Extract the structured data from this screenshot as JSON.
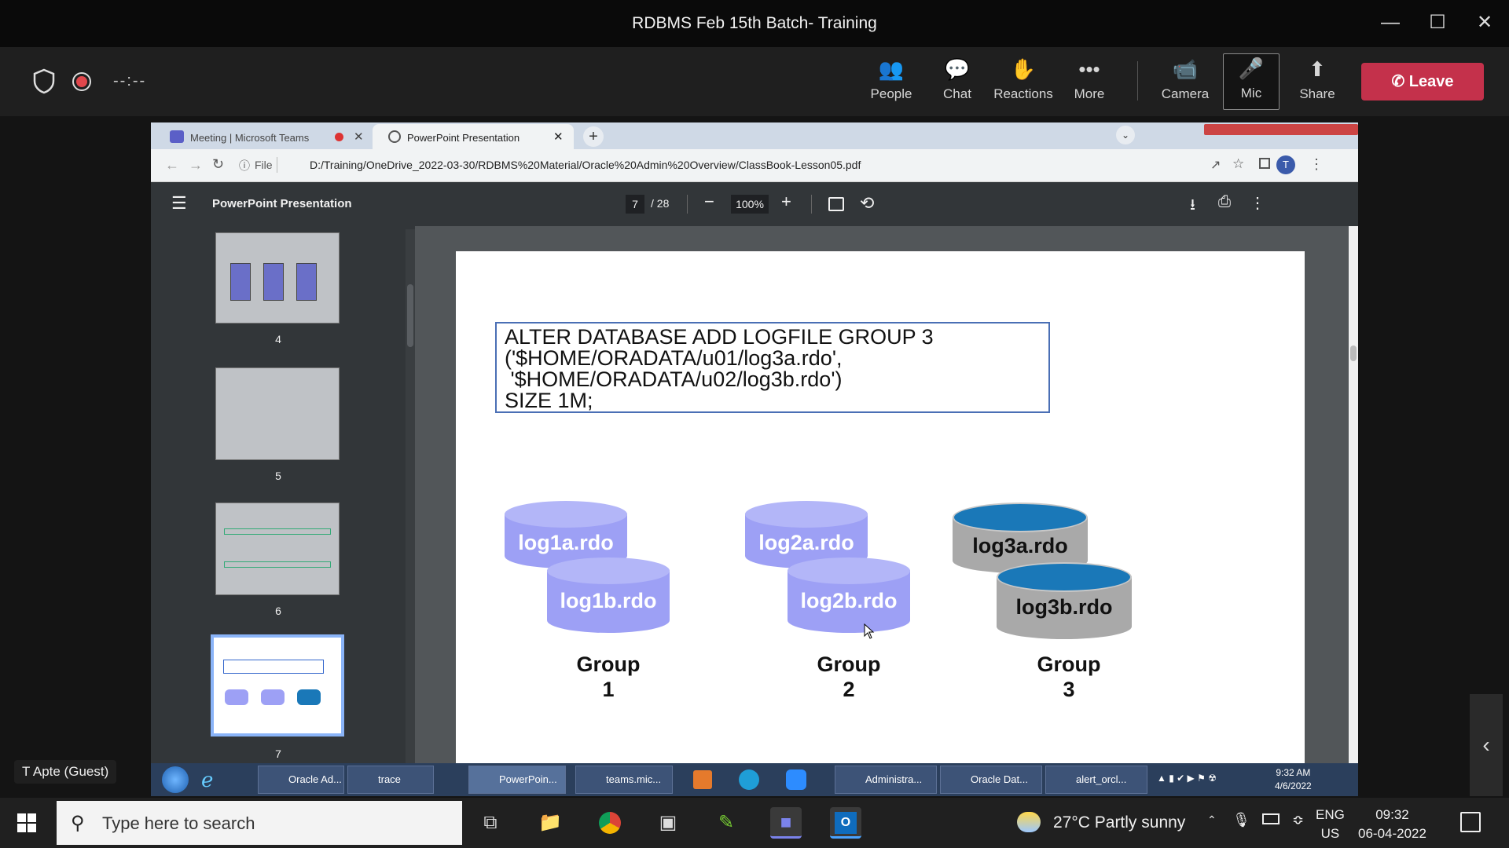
{
  "window": {
    "title": "RDBMS Feb 15th Batch- Training",
    "minimize_icon": "minimize-icon",
    "maximize_icon": "maximize-icon",
    "close_icon": "close-icon"
  },
  "meeting": {
    "timer": "--:--",
    "controls": [
      {
        "label": "People",
        "icon": "people-icon"
      },
      {
        "label": "Chat",
        "icon": "chat-icon"
      },
      {
        "label": "Reactions",
        "icon": "reactions-icon"
      },
      {
        "label": "More",
        "icon": "more-icon"
      },
      {
        "label": "Camera",
        "icon": "camera-off-icon"
      },
      {
        "label": "Mic",
        "icon": "mic-off-icon"
      },
      {
        "label": "Share",
        "icon": "share-icon"
      }
    ],
    "leave_label": "Leave",
    "guest_name": "T Apte (Guest)"
  },
  "browser": {
    "tabs": [
      {
        "label": "Meeting | Microsoft Teams"
      },
      {
        "label": "PowerPoint Presentation"
      }
    ],
    "url_prefix": "File",
    "url": "D:/Training/OneDrive_2022-03-30/RDBMS%20Material/Oracle%20Admin%20Overview/ClassBook-Lesson05.pdf",
    "profile_initial": "T"
  },
  "pdf": {
    "title": "PowerPoint Presentation",
    "current_page": "7",
    "total_pages": "/ 28",
    "zoom": "100%",
    "thumbnails": [
      "4",
      "5",
      "6",
      "7"
    ],
    "code": "ALTER DATABASE ADD LOGFILE GROUP 3\n('$HOME/ORADATA/u01/log3a.rdo',\n '$HOME/ORADATA/u02/log3b.rdo')\nSIZE 1M;",
    "cylinders": [
      "log1a.rdo",
      "log1b.rdo",
      "log2a.rdo",
      "log2b.rdo",
      "log3a.rdo",
      "log3b.rdo"
    ],
    "groups": [
      {
        "name": "Group",
        "num": "1"
      },
      {
        "name": "Group",
        "num": "2"
      },
      {
        "name": "Group",
        "num": "3"
      }
    ]
  },
  "inner_taskbar": {
    "items": [
      "Oracle Ad...",
      "trace",
      "PowerPoin...",
      "teams.mic...",
      "Administra...",
      "Oracle Dat...",
      "alert_orcl..."
    ],
    "time": "9:32 AM",
    "date": "4/6/2022"
  },
  "taskbar": {
    "search_placeholder": "Type here to search",
    "weather": "27°C  Partly sunny",
    "lang_line1": "ENG",
    "lang_line2": "US",
    "time": "09:32",
    "date": "06-04-2022"
  },
  "colors": {
    "leave": "#c4314b",
    "cyl_purple": "#9da0f5",
    "cyl_teal_top": "#1a78b8",
    "cyl_gray": "#a9a9a9"
  }
}
